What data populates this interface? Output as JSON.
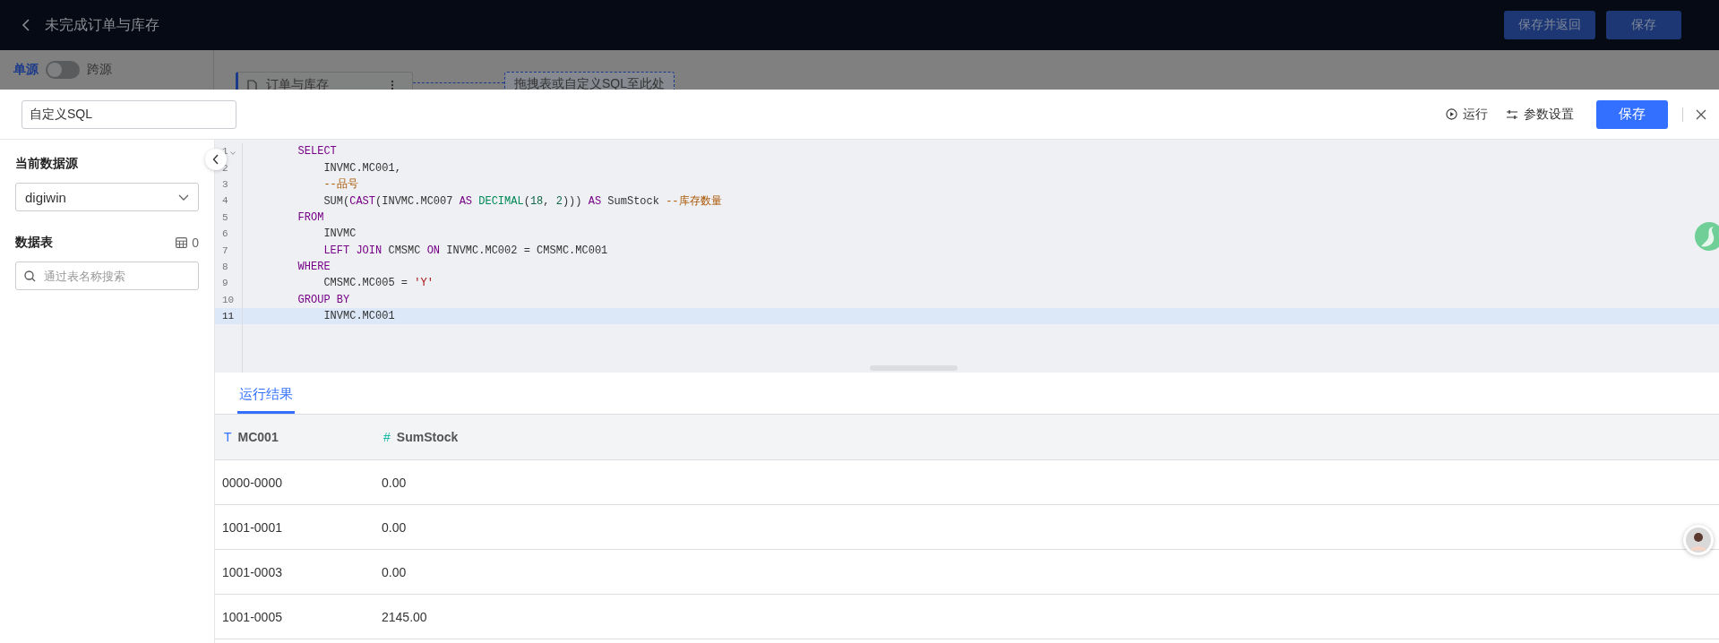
{
  "header": {
    "title": "未完成订单与库存",
    "buttons": [
      {
        "label": "保存并返回",
        "kind": "secondary"
      },
      {
        "label": "保存",
        "kind": "primary"
      }
    ]
  },
  "background": {
    "mode_switch": {
      "left": "单源",
      "right": "跨源",
      "on": false
    },
    "node": {
      "label": "订单与库存"
    },
    "drop_zone": {
      "text": "拖拽表或自定义SQL至此处"
    }
  },
  "dialog": {
    "name_field": {
      "value": "自定义SQL"
    },
    "toolbar": [
      {
        "kind": "run",
        "label": "运行"
      },
      {
        "kind": "params",
        "label": "参数设置"
      }
    ],
    "save_button": {
      "label": "保存"
    },
    "sidebar": {
      "source_label": "当前数据源",
      "source_value": "digiwin",
      "tables_label": "数据表",
      "table_count": "0",
      "search": {
        "placeholder": "通过表名称搜索"
      }
    },
    "editor": {
      "lines": [
        {
          "number": "1",
          "active": false,
          "foldable": true,
          "tokens": [
            {
              "kind": "keyword",
              "text": "        SELECT"
            }
          ]
        },
        {
          "number": "2",
          "active": false,
          "foldable": false,
          "tokens": [
            {
              "kind": "plain",
              "text": "            INVMC.MC001,"
            }
          ]
        },
        {
          "number": "3",
          "active": false,
          "foldable": false,
          "tokens": [
            {
              "kind": "comment",
              "text": "            --品号"
            }
          ]
        },
        {
          "number": "4",
          "active": false,
          "foldable": false,
          "tokens": [
            {
              "kind": "plain",
              "text": "            SUM("
            },
            {
              "kind": "keyword",
              "text": "CAST"
            },
            {
              "kind": "plain",
              "text": "(INVMC.MC007 "
            },
            {
              "kind": "keyword",
              "text": "AS "
            },
            {
              "kind": "type",
              "text": "DECIMAL"
            },
            {
              "kind": "plain",
              "text": "("
            },
            {
              "kind": "number",
              "text": "18"
            },
            {
              "kind": "plain",
              "text": ", "
            },
            {
              "kind": "number",
              "text": "2"
            },
            {
              "kind": "plain",
              "text": "))) "
            },
            {
              "kind": "keyword",
              "text": "AS"
            },
            {
              "kind": "plain",
              "text": " SumStock "
            },
            {
              "kind": "comment",
              "text": "--库存数量"
            }
          ]
        },
        {
          "number": "5",
          "active": false,
          "foldable": false,
          "tokens": [
            {
              "kind": "keyword",
              "text": "        FROM"
            }
          ]
        },
        {
          "number": "6",
          "active": false,
          "foldable": false,
          "tokens": [
            {
              "kind": "plain",
              "text": "            INVMC"
            }
          ]
        },
        {
          "number": "7",
          "active": false,
          "foldable": false,
          "tokens": [
            {
              "kind": "keyword",
              "text": "            LEFT JOIN"
            },
            {
              "kind": "plain",
              "text": " CMSMC "
            },
            {
              "kind": "keyword",
              "text": "ON"
            },
            {
              "kind": "plain",
              "text": " INVMC.MC002 = CMSMC.MC001"
            }
          ]
        },
        {
          "number": "8",
          "active": false,
          "foldable": false,
          "tokens": [
            {
              "kind": "keyword",
              "text": "        WHERE"
            }
          ]
        },
        {
          "number": "9",
          "active": false,
          "foldable": false,
          "tokens": [
            {
              "kind": "plain",
              "text": "            CMSMC.MC005 = "
            },
            {
              "kind": "string",
              "text": "'Y'"
            }
          ]
        },
        {
          "number": "10",
          "active": false,
          "foldable": false,
          "tokens": [
            {
              "kind": "keyword",
              "text": "        GROUP BY"
            }
          ]
        },
        {
          "number": "11",
          "active": true,
          "foldable": false,
          "tokens": [
            {
              "kind": "plain",
              "text": "            INVMC.MC001"
            }
          ]
        }
      ]
    },
    "results": {
      "tabs": [
        {
          "label": "运行结果",
          "selected": true
        }
      ],
      "table": {
        "columns": [
          {
            "name": "MC001",
            "color": "#3370ff",
            "type_icon": "T"
          },
          {
            "name": "SumStock",
            "color": "#14b8a6",
            "type_icon": "#"
          }
        ],
        "rows": [
          [
            "0000-0000",
            "0.00"
          ],
          [
            "1001-0001",
            "0.00"
          ],
          [
            "1001-0003",
            "0.00"
          ],
          [
            "1001-0005",
            "2145.00"
          ]
        ]
      }
    }
  }
}
